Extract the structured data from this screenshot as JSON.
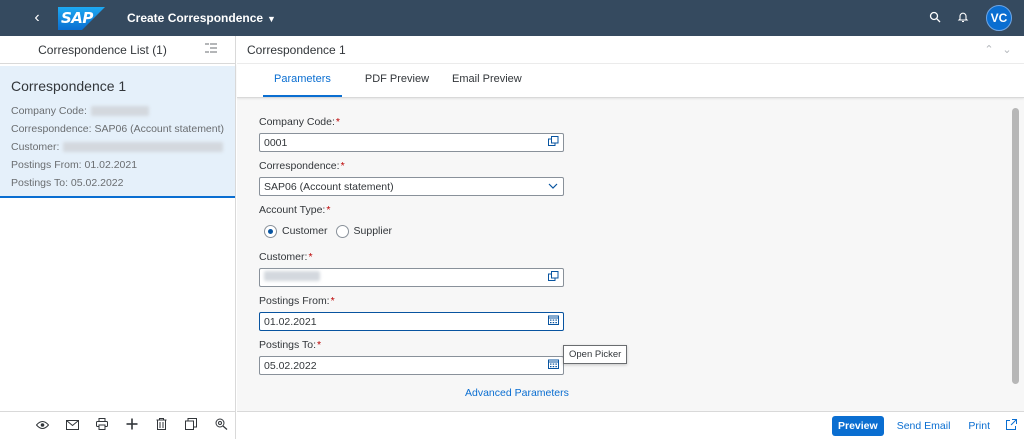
{
  "shell": {
    "back_icon": "back-icon",
    "logo_text": "SAP",
    "app_title": "Create Correspondence",
    "title_caret": "▼",
    "avatar_initials": "VC",
    "brand_color": "#354a5f",
    "accent_color": "#0a6ed1"
  },
  "master": {
    "title": "Correspondence List (1)",
    "items": [
      {
        "title": "Correspondence 1",
        "company_code_label": "Company Code:",
        "correspondence_text": "Correspondence: SAP06 (Account statement)",
        "customer_label": "Customer:",
        "postings_from_text": "Postings From: 01.02.2021",
        "postings_to_text": "Postings To: 05.02.2022"
      }
    ],
    "footer_icons": [
      "preview-icon",
      "email-icon",
      "print-icon",
      "add-icon",
      "delete-icon",
      "copy-icon",
      "settings-search-icon"
    ]
  },
  "detail": {
    "title": "Correspondence 1",
    "tabs": [
      {
        "label": "Parameters",
        "active": true
      },
      {
        "label": "PDF Preview",
        "active": false
      },
      {
        "label": "Email Preview",
        "active": false
      }
    ],
    "form": {
      "company_code_label": "Company Code:",
      "company_code_value": "0001",
      "correspondence_label": "Correspondence:",
      "correspondence_value": "SAP06 (Account statement)",
      "account_type_label": "Account Type:",
      "account_type_options": [
        "Customer",
        "Supplier"
      ],
      "account_type_selected": "Customer",
      "customer_label": "Customer:",
      "postings_from_label": "Postings From:",
      "postings_from_value": "01.02.2021",
      "postings_to_label": "Postings To:",
      "postings_to_value": "05.02.2022",
      "required_marker": "*"
    },
    "tooltip": "Open Picker",
    "advanced_link": "Advanced Parameters",
    "footer": {
      "preview": "Preview",
      "send_email": "Send Email",
      "print": "Print"
    }
  }
}
